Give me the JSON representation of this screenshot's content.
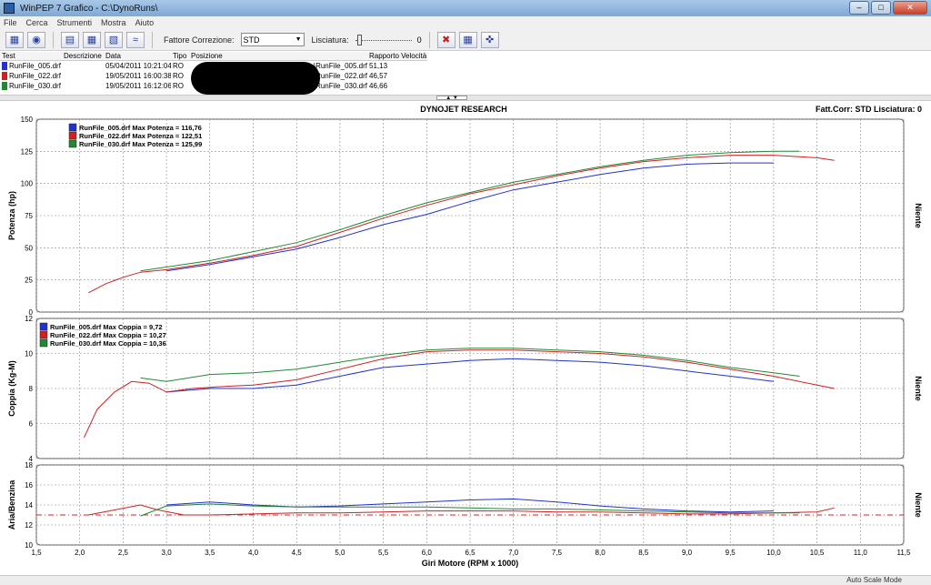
{
  "window": {
    "title": "WinPEP 7   Grafico - C:\\DynoRuns\\"
  },
  "menu": [
    "File",
    "Cerca",
    "Strumenti",
    "Mostra",
    "Aiuto"
  ],
  "toolbar": {
    "fattore_label": "Fattore Correzione:",
    "fattore_value": "STD",
    "lisciatura_label": "Lisciatura:",
    "lisciatura_value": "0"
  },
  "runs": {
    "headers": [
      "Test",
      "Descrizione",
      "Data",
      "Tipo",
      "Posizione",
      "Rapporto Velocità"
    ],
    "rows": [
      {
        "test": "RunFile_005.drf",
        "data": "05/04/2011 10:21:04",
        "tipo": "RO",
        "posizione": "\\RunFile_005.drf",
        "rapporto": "51,13",
        "color": "#2233cc"
      },
      {
        "test": "RunFile_022.drf",
        "data": "19/05/2011 16:00:38",
        "tipo": "RO",
        "posizione": "\\RunFile_022.drf",
        "rapporto": "46,57",
        "color": "#cc2222"
      },
      {
        "test": "RunFile_030.drf",
        "data": "19/05/2011 16:12:06",
        "tipo": "RO",
        "posizione": "\\RunFile_030.drf",
        "rapporto": "46,66",
        "color": "#228833"
      }
    ]
  },
  "header": {
    "center": "DYNOJET RESEARCH",
    "right": "Fatt.Corr: STD  Lisciatura: 0"
  },
  "status": {
    "mode": "Auto Scale Mode"
  },
  "chart_data": [
    {
      "type": "line",
      "ylabel": "Potenza (hp)",
      "right_label": "Niente",
      "ylim": [
        0,
        150
      ],
      "yticks": [
        0,
        25,
        50,
        75,
        100,
        125,
        150
      ],
      "legend": [
        "RunFile_005.drf Max Potenza = 116,76",
        "RunFile_022.drf Max Potenza = 122,51",
        "RunFile_030.drf Max Potenza = 125,99"
      ],
      "series": [
        {
          "name": "RunFile_005.drf",
          "color": "#2233cc",
          "x": [
            3.0,
            3.5,
            4.0,
            4.5,
            5.0,
            5.5,
            6.0,
            6.5,
            7.0,
            7.5,
            8.0,
            8.5,
            9.0,
            9.5,
            10.0
          ],
          "y": [
            32,
            37,
            43,
            49,
            58,
            68,
            76,
            86,
            95,
            101,
            107,
            112,
            115,
            116,
            116
          ]
        },
        {
          "name": "RunFile_022.drf",
          "color": "#cc2222",
          "x": [
            2.1,
            2.3,
            2.5,
            2.7,
            3.0,
            3.5,
            4.0,
            4.5,
            5.0,
            5.5,
            6.0,
            6.5,
            7.0,
            7.5,
            8.0,
            8.5,
            9.0,
            9.5,
            10.0,
            10.5,
            10.7
          ],
          "y": [
            15,
            22,
            27,
            31,
            33,
            38,
            44,
            51,
            62,
            73,
            83,
            92,
            99,
            106,
            112,
            117,
            120,
            122,
            122,
            120,
            118
          ]
        },
        {
          "name": "RunFile_030.drf",
          "color": "#228833",
          "x": [
            2.7,
            3.0,
            3.5,
            4.0,
            4.5,
            5.0,
            5.5,
            6.0,
            6.5,
            7.0,
            7.5,
            8.0,
            8.5,
            9.0,
            9.5,
            10.0,
            10.3
          ],
          "y": [
            32,
            35,
            40,
            47,
            54,
            64,
            75,
            85,
            93,
            101,
            107,
            113,
            118,
            122,
            124,
            125,
            125
          ]
        }
      ]
    },
    {
      "type": "line",
      "ylabel": "Coppia (Kg-M)",
      "right_label": "Niente",
      "ylim": [
        4,
        12
      ],
      "yticks": [
        4,
        6,
        8,
        10,
        12
      ],
      "legend": [
        "RunFile_005.drf Max Coppia = 9,72",
        "RunFile_022.drf Max Coppia = 10,27",
        "RunFile_030.drf Max Coppia = 10,36"
      ],
      "series": [
        {
          "name": "RunFile_005.drf",
          "color": "#2233cc",
          "x": [
            3.0,
            3.5,
            4.0,
            4.5,
            5.0,
            5.5,
            6.0,
            6.5,
            7.0,
            7.5,
            8.0,
            8.5,
            9.0,
            9.5,
            10.0
          ],
          "y": [
            7.8,
            8.0,
            8.0,
            8.2,
            8.7,
            9.2,
            9.4,
            9.6,
            9.7,
            9.6,
            9.5,
            9.3,
            9.0,
            8.7,
            8.4
          ]
        },
        {
          "name": "RunFile_022.drf",
          "color": "#cc2222",
          "x": [
            2.05,
            2.2,
            2.4,
            2.6,
            2.8,
            3.0,
            3.3,
            3.6,
            4.0,
            4.5,
            5.0,
            5.5,
            6.0,
            6.5,
            7.0,
            7.5,
            8.0,
            8.5,
            9.0,
            9.5,
            10.0,
            10.5,
            10.7
          ],
          "y": [
            5.2,
            6.8,
            7.8,
            8.4,
            8.3,
            7.8,
            8.0,
            8.1,
            8.2,
            8.5,
            9.1,
            9.7,
            10.1,
            10.2,
            10.2,
            10.1,
            10.0,
            9.8,
            9.5,
            9.1,
            8.7,
            8.2,
            8.0
          ]
        },
        {
          "name": "RunFile_030.drf",
          "color": "#228833",
          "x": [
            2.7,
            3.0,
            3.5,
            4.0,
            4.5,
            5.0,
            5.5,
            6.0,
            6.5,
            7.0,
            7.5,
            8.0,
            8.5,
            9.0,
            9.5,
            10.0,
            10.3
          ],
          "y": [
            8.6,
            8.4,
            8.8,
            8.9,
            9.1,
            9.5,
            9.9,
            10.2,
            10.3,
            10.3,
            10.2,
            10.1,
            9.9,
            9.6,
            9.2,
            8.9,
            8.7
          ]
        }
      ]
    },
    {
      "type": "line",
      "ylabel": "Aria/Benzina",
      "right_label": "Niente",
      "ylim": [
        10,
        18
      ],
      "yticks": [
        10,
        12,
        14,
        16,
        18
      ],
      "reference_line": 13.0,
      "xlabel": "Giri Motore (RPM x 1000)",
      "xlim": [
        1.5,
        11.5
      ],
      "xticks": [
        1.5,
        2.0,
        2.5,
        3.0,
        3.5,
        4.0,
        4.5,
        5.0,
        5.5,
        6.0,
        6.5,
        7.0,
        7.5,
        8.0,
        8.5,
        9.0,
        9.5,
        10.0,
        10.5,
        11.0,
        11.5
      ],
      "xtick_labels": [
        "1,5",
        "2,0",
        "2,5",
        "3,0",
        "3,5",
        "4,0",
        "4,5",
        "5,0",
        "5,5",
        "6,0",
        "6,5",
        "7,0",
        "7,5",
        "8,0",
        "8,5",
        "9,0",
        "9,5",
        "10,0",
        "10,5",
        "11,0",
        "11,5"
      ],
      "series": [
        {
          "name": "RunFile_005.drf",
          "color": "#2233cc",
          "x": [
            3.0,
            3.5,
            4.0,
            4.5,
            5.0,
            5.5,
            6.0,
            6.5,
            7.0,
            7.5,
            8.0,
            8.5,
            9.0,
            9.5,
            10.0
          ],
          "y": [
            14.0,
            14.3,
            14.0,
            13.8,
            13.9,
            14.1,
            14.3,
            14.5,
            14.6,
            14.3,
            13.9,
            13.6,
            13.4,
            13.3,
            13.4
          ]
        },
        {
          "name": "RunFile_022.drf",
          "color": "#cc2222",
          "x": [
            2.1,
            2.4,
            2.7,
            2.9,
            3.2,
            3.5,
            4.0,
            4.5,
            5.0,
            5.5,
            6.0,
            6.5,
            7.0,
            7.5,
            8.0,
            8.5,
            9.0,
            9.5,
            10.0,
            10.5,
            10.7
          ],
          "y": [
            13.0,
            13.5,
            14.0,
            13.5,
            13.0,
            13.0,
            13.1,
            13.2,
            13.2,
            13.3,
            13.4,
            13.4,
            13.4,
            13.3,
            13.3,
            13.2,
            13.1,
            13.1,
            13.2,
            13.3,
            13.7
          ]
        },
        {
          "name": "RunFile_030.drf",
          "color": "#228833",
          "x": [
            2.7,
            3.0,
            3.5,
            4.0,
            4.5,
            5.0,
            5.5,
            6.0,
            6.5,
            7.0,
            7.5,
            8.0,
            8.5,
            9.0,
            9.5,
            10.0,
            10.3
          ],
          "y": [
            12.9,
            13.9,
            14.1,
            13.9,
            13.8,
            13.8,
            13.8,
            13.8,
            13.7,
            13.6,
            13.6,
            13.5,
            13.4,
            13.3,
            13.2,
            13.2,
            13.2
          ]
        }
      ]
    }
  ]
}
